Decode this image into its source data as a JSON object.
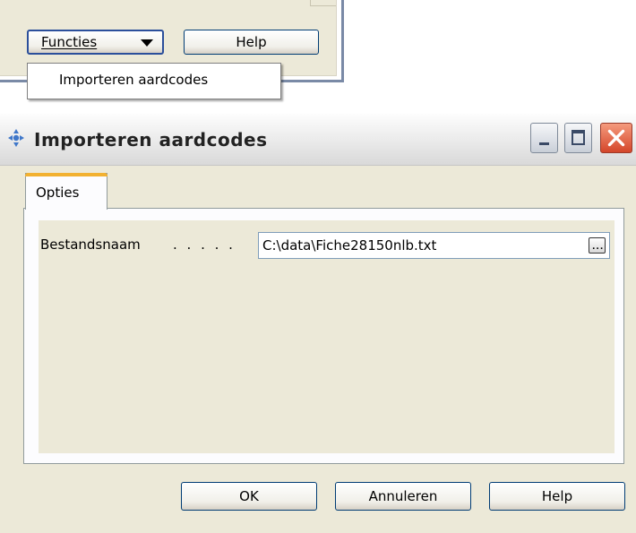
{
  "parent_window": {
    "functies_label": "Functies",
    "help_label": "Help",
    "dropdown_items": [
      "Importeren aardcodes"
    ]
  },
  "dialog": {
    "title": "Importeren aardcodes",
    "tabs": [
      {
        "label": "Opties",
        "active": true
      }
    ],
    "fields": {
      "bestandsnaam": {
        "label": "Bestandsnaam",
        "leader": ". . . . .",
        "value": "C:\\data\\Fiche28150nlb.txt"
      }
    },
    "buttons": {
      "ok_label": "OK",
      "cancel_label": "Annuleren",
      "help_label": "Help"
    }
  },
  "colors": {
    "dialog_background": "#ece9d8",
    "tab_accent": "#f2b131",
    "close_button": "#d4462a",
    "button_border": "#003c74"
  },
  "icons": [
    "app-icon",
    "minimize-icon",
    "maximize-icon",
    "close-icon",
    "dropdown-arrow-icon",
    "browse-ellipsis-icon"
  ]
}
